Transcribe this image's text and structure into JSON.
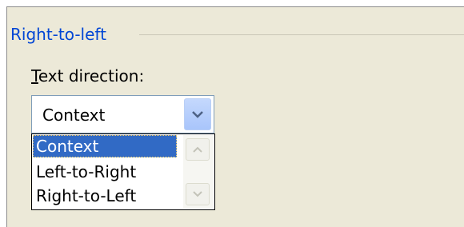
{
  "group": {
    "title": "Right-to-left"
  },
  "text_direction": {
    "label_accel": "T",
    "label_rest": "ext direction:",
    "selected_value": "Context",
    "options": [
      "Context",
      "Left-to-Right",
      "Right-to-Left"
    ]
  },
  "colors": {
    "group_title": "#0046d5",
    "selection": "#316ac5",
    "combo_border": "#7f9db9"
  }
}
